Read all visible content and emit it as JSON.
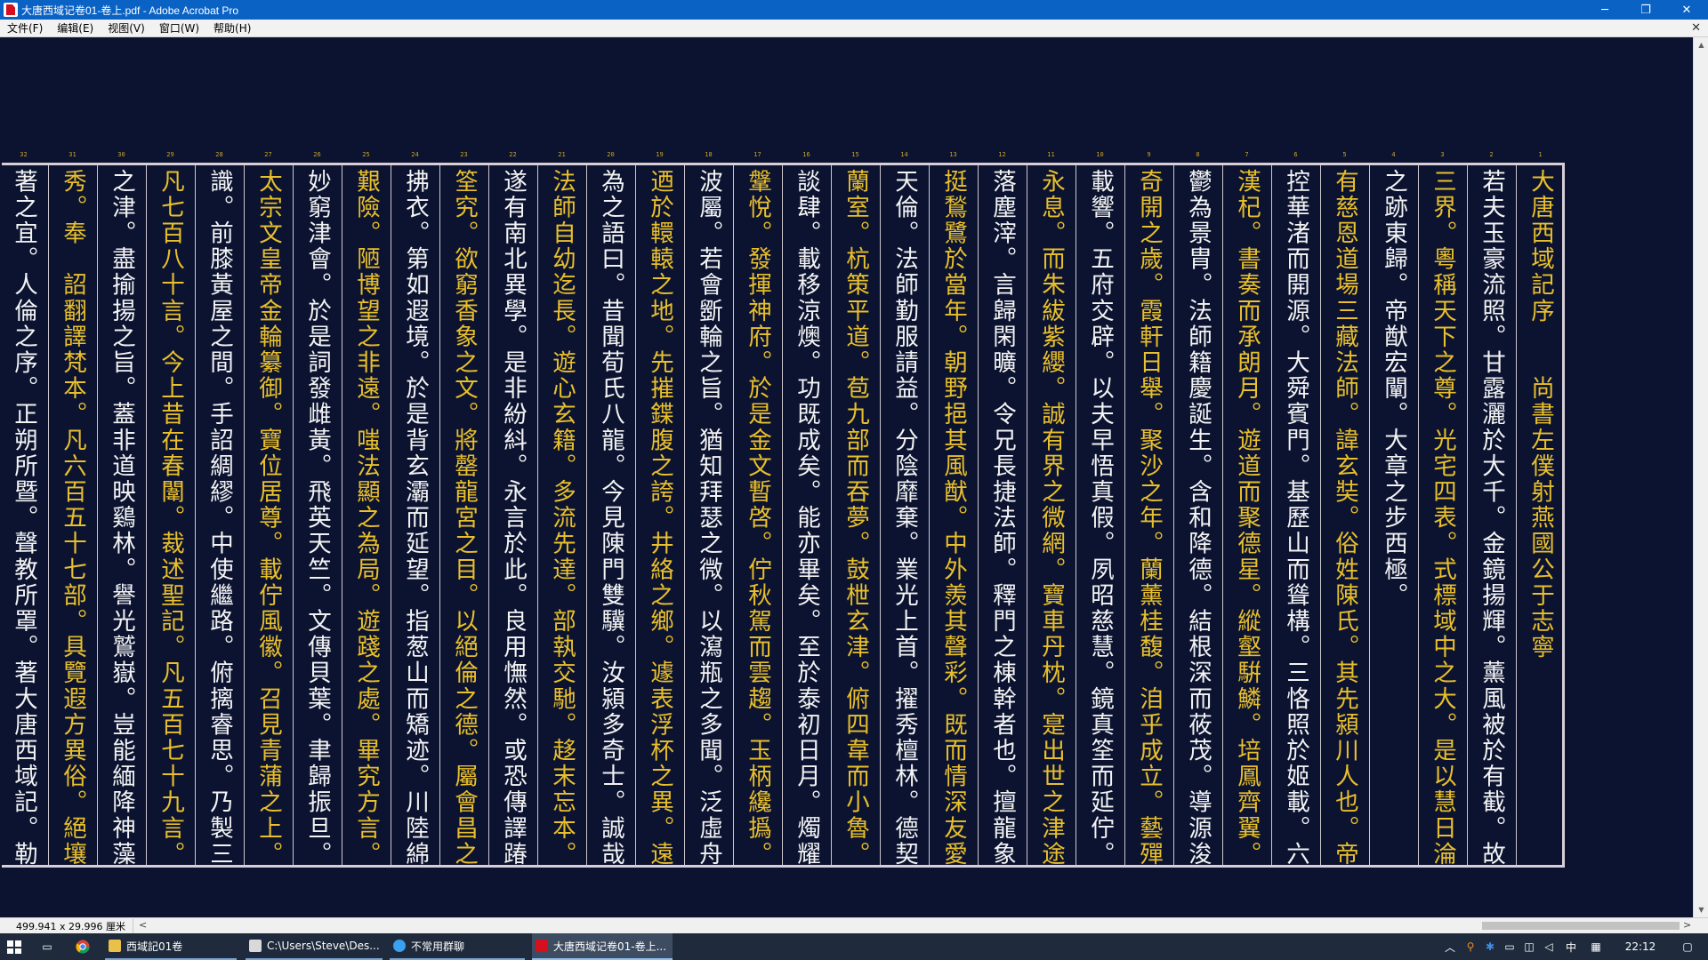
{
  "window": {
    "title": "大唐西域记卷01-卷上.pdf - Adobe Acrobat Pro",
    "controls": {
      "minimize": "─",
      "restore": "❐",
      "close": "✕"
    }
  },
  "menu": [
    "文件(F)",
    "编辑(E)",
    "视图(V)",
    "窗口(W)",
    "帮助(H)"
  ],
  "menu_close": "✕",
  "document": {
    "column_numbers": [
      "1",
      "2",
      "3",
      "4",
      "5",
      "6",
      "7",
      "8",
      "9",
      "10",
      "11",
      "12",
      "13",
      "14",
      "15",
      "16",
      "17",
      "18",
      "19",
      "20",
      "21",
      "22",
      "23",
      "24",
      "25",
      "26",
      "27",
      "28",
      "29",
      "30",
      "31",
      "32"
    ],
    "columns": [
      {
        "text": "大唐西域記序　　尚書左僕射燕國公于志寧",
        "color": "gold"
      },
      {
        "text": "若夫玉豪流照。甘露灑於大千。金鏡揚輝。薰風被於有截。故知示現",
        "color": "white"
      },
      {
        "text": "三界。粵稱天下之尊。光宅四表。式標域中之大。是以慧日淪影。象化",
        "color": "gold"
      },
      {
        "text": "之跡東歸。帝猷宏闡。大章之步西極。",
        "color": "white"
      },
      {
        "text": "有慈恩道場三藏法師。諱玄奘。俗姓陳氏。其先潁川人也。帝軒提象。",
        "color": "gold"
      },
      {
        "text": "控華渚而開源。大舜賓門。基歷山而聳構。三恪照於姬載。六奇光於",
        "color": "white"
      },
      {
        "text": "漢杞。書奏而承朗月。遊道而聚德星。縱壑騈鱗。培鳳齊翼。世濟之美。",
        "color": "gold"
      },
      {
        "text": "鬱為景胄。法師籍慶誕生。含和降德。結根深而莜茂。導源浚而靈長。",
        "color": "white"
      },
      {
        "text": "奇開之歲。霞軒日舉。聚沙之年。蘭薰桂馥。洎乎成立。藝殫墳素。九皐",
        "color": "gold"
      },
      {
        "text": "載響。五府交辟。以夫早悟真假。夙昭慈慧。鏡真筌而延佇。顧生涯而",
        "color": "white"
      },
      {
        "text": "永息。而朱紱紫纓。誠有界之微網。寶車丹枕。寔出世之津途。由是擯",
        "color": "gold"
      },
      {
        "text": "落塵滓。言歸閑曠。令兄長捷法師。釋門之棟幹者也。擅龍象於身世。",
        "color": "white"
      },
      {
        "text": "挺鶖鷺於當年。朝野挹其風猷。中外羨其聲彩。既而情深友愛。道睦",
        "color": "gold"
      },
      {
        "text": "天倫。法師勤服請益。分陰靡棄。業光上首。擢秀檀林。德契中庸。騰芬",
        "color": "white"
      },
      {
        "text": "蘭室。杭策平道。苞九部而吞夢。鼓枻玄津。俯四韋而小魯。自茲遍遊",
        "color": "gold"
      },
      {
        "text": "談肆。載移涼燠。功既成矣。能亦畢矣。至於泰初日月。燭耀靈臺。子雲",
        "color": "white"
      },
      {
        "text": "鞶悅。發揮神府。於是金文暫啓。佇秋駕而雲趨。玉柄纔撝。披霧布而",
        "color": "gold"
      },
      {
        "text": "波屬。若會斵輪之旨。猶知拜瑟之微。以瀉瓶之多聞。泛虛舟而獨遠。",
        "color": "white"
      },
      {
        "text": "迺於轘轅之地。先摧鍱腹之誇。井絡之鄉。遽表浮杯之異。遠迩宗挹。",
        "color": "gold"
      },
      {
        "text": "為之語曰。昔聞荀氏八龍。今見陳門雙驥。汝潁多奇士。誠哉此言。",
        "color": "white"
      },
      {
        "text": "法師自幼迄長。遊心玄籍。多流先達。部執交馳。趍末忘本。摭華捐實。",
        "color": "gold"
      },
      {
        "text": "遂有南北異學。是非紛紏。永言於此。良用憮然。或恐傳譯踳駁。未能",
        "color": "white"
      },
      {
        "text": "筌究。欲窮香象之文。將罄龍宮之目。以絕倫之德。屬會昌之期。杖錫",
        "color": "gold"
      },
      {
        "text": "拂衣。第如遐境。於是背玄灞而延望。指葱山而矯迹。川陸綿長。備嘗",
        "color": "white"
      },
      {
        "text": "艱險。陋博望之非遠。嗤法顯之為局。遊踐之處。畢究方言。鐫求幽賾。",
        "color": "gold"
      },
      {
        "text": "妙窮津會。於是詞發雌黃。飛英天竺。文傳貝葉。聿歸振旦。",
        "color": "white"
      },
      {
        "text": "太宗文皇帝金輪纂御。寶位居尊。載佇風徽。召見青蒲之上。迺睠通",
        "color": "gold"
      },
      {
        "text": "識。前膝黃屋之間。手詔綢繆。中使繼路。俯摛睿思。乃製三藏聖教序。",
        "color": "white"
      },
      {
        "text": "凡七百八十言。今上昔在春闈。裁述聖記。凡五百七十九言。啓玄妙",
        "color": "gold"
      },
      {
        "text": "之津。盡揄揚之旨。蓋非道映鷄林。譽光鷲嶽。豈能緬降神藻。以旌時",
        "color": "white"
      },
      {
        "text": "秀。奉　詔翻譯梵本。凡六百五十七部。具覽遐方異俗。絕壤殊風。土",
        "color": "gold"
      },
      {
        "text": "著之宜。人倫之序。正朔所暨。聲教所罩。著大唐西域記。勒成一十二",
        "color": "white"
      }
    ]
  },
  "status": {
    "page_size": "499.941 x 29.996 厘米",
    "scroll_left": "<",
    "scroll_right": ">"
  },
  "taskbar": {
    "tasks": [
      {
        "label": "西域記01卷",
        "color": "#e8c04a"
      },
      {
        "label": "C:\\Users\\Steve\\Des...",
        "color": "#d9d9d9"
      },
      {
        "label": "不常用群聊",
        "color": "#3aa0f0"
      },
      {
        "label": "大唐西域记卷01-卷上...",
        "color": "#d4101e"
      }
    ],
    "ime": "中",
    "time": "22:12"
  }
}
